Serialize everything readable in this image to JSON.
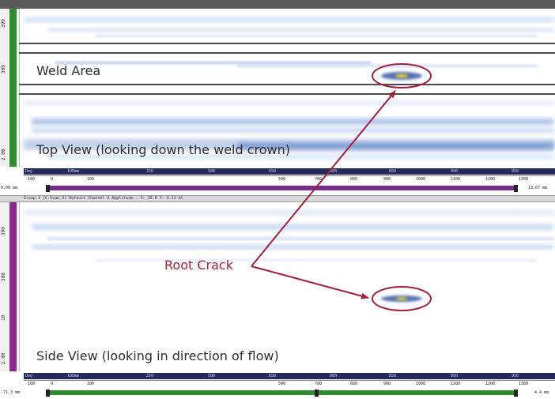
{
  "annotations": {
    "weld_area": "Weld Area",
    "top_view": "Top View (looking down the weld crown)",
    "side_view": "Side View (looking in direction of flow)",
    "root_crack": "Root Crack"
  },
  "top_panel": {
    "ruler_ticks": [
      "390",
      "300",
      "2.00"
    ],
    "axis_units": "Deg",
    "axis_mm": "100mm",
    "axis_upper_labels": [
      "250",
      "500",
      "650",
      "800",
      "850",
      "900",
      "950"
    ],
    "axis_lower_labels": [
      "-100",
      "0",
      "100",
      "500",
      "700",
      "800",
      "900",
      "1000",
      "1100",
      "1200",
      "1300"
    ],
    "range_start": "0.00 mm",
    "range_end": "13.67 mm",
    "track_color": "#7b2a8f",
    "strip_color": "#2e8b2e"
  },
  "status_bar": {
    "text": "Group 1 (C-Scan 3) Default Channel A Amplitude - X: 10.0 Y: 4.11 ml"
  },
  "bottom_panel": {
    "ruler_ticks": [
      "390",
      "300",
      "10",
      "2.00"
    ],
    "axis_units": "Deg",
    "axis_mm": "100mm",
    "axis_upper_labels": [
      "250",
      "500",
      "650",
      "800",
      "850",
      "900",
      "950"
    ],
    "axis_lower_labels": [
      "-100",
      "0",
      "100",
      "500",
      "700",
      "800",
      "900",
      "1000",
      "1100",
      "1200",
      "1300"
    ],
    "range_start": "-71.3 mm",
    "range_end": "4.4 mm",
    "track_color": "#2e8b2e",
    "strip_color": "#8a2a8f"
  },
  "colors": {
    "callout": "#a0213a",
    "scan_blue": "#3c67b8",
    "defect_core": "#e2c93a"
  }
}
